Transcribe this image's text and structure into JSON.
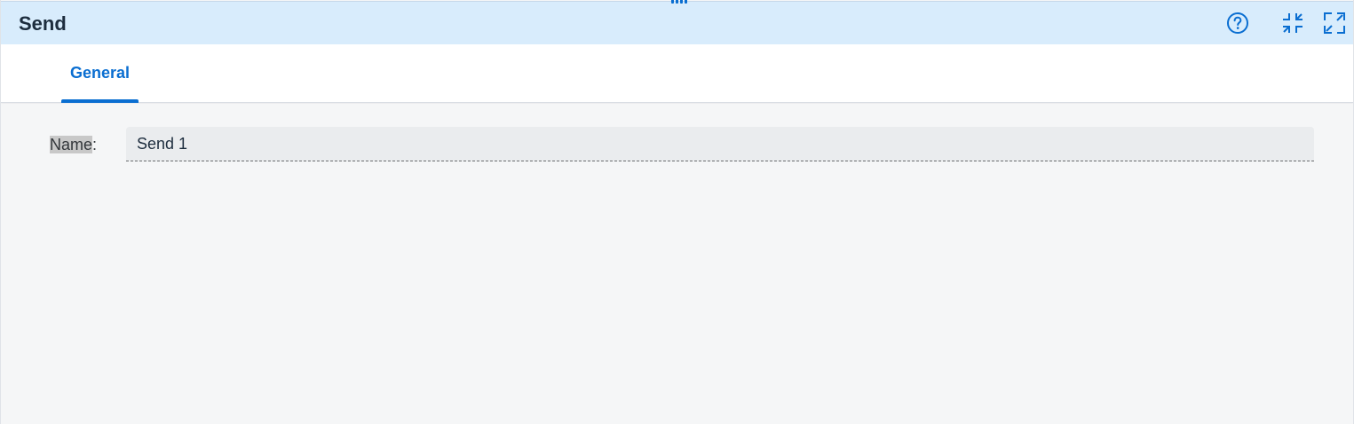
{
  "window": {
    "title": "Send"
  },
  "toolbar": {
    "icons": [
      "help-icon",
      "exit-fullscreen-icon",
      "fullscreen-icon"
    ]
  },
  "tabs": [
    {
      "label": "General",
      "active": true
    }
  ],
  "form": {
    "name_label": "Name",
    "name_label_suffix": ":",
    "name_value": "Send 1"
  },
  "colors": {
    "accent": "#0a6ed1",
    "header_bg": "#d8ecfc",
    "content_bg": "#f5f6f7",
    "input_bg": "#eaecee",
    "title_text": "#1d2d3e"
  }
}
